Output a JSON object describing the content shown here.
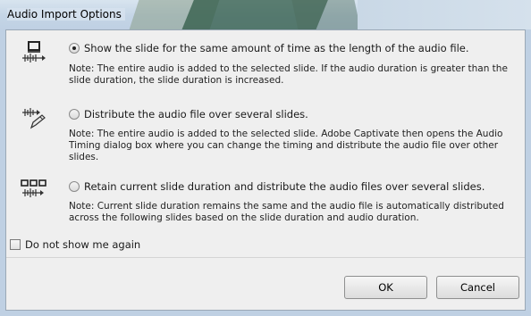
{
  "window": {
    "title": "Audio Import Options"
  },
  "options": [
    {
      "icon": "slide-audio-icon",
      "label": "Show the slide for the same amount of time as the length of the audio file.",
      "selected": true,
      "note": "Note: The entire audio is added to the selected slide. If the audio duration is greater than the slide duration, the slide duration is increased."
    },
    {
      "icon": "distribute-audio-pencil-icon",
      "label": "Distribute the audio file over several slides.",
      "selected": false,
      "note": "Note: The entire audio is added to the selected slide. Adobe Captivate then opens the Audio Timing dialog box where you can change the timing and distribute the audio file over other slides."
    },
    {
      "icon": "multi-slide-audio-icon",
      "label": "Retain current slide duration and distribute the audio files over several slides.",
      "selected": false,
      "note": "Note: Current slide duration remains the same and the audio file is automatically distributed across the following slides based on the slide duration and audio duration."
    }
  ],
  "checkbox": {
    "label": "Do not show me again",
    "checked": false
  },
  "buttons": {
    "ok": "OK",
    "cancel": "Cancel"
  }
}
